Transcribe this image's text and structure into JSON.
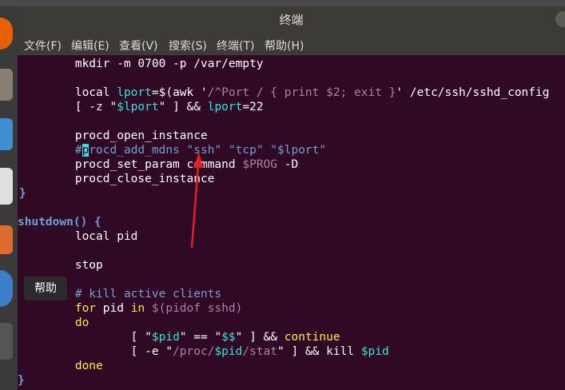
{
  "window": {
    "title": "终端",
    "top_text": "终端"
  },
  "menu": [
    "文件(F)",
    "编辑(E)",
    "查看(V)",
    "搜索(S)",
    "终端(T)",
    "帮助(H)"
  ],
  "tooltip": "帮助",
  "terminal": {
    "l1": "        mkdir -m 0700 -p /var/empty",
    "l2a": "        local ",
    "l2b": "lport",
    "l2c": "=$(awk '",
    "l2d": "/^Port / { print $2; exit }",
    "l2e": "' /etc/ssh/sshd_config",
    "l3a": "        [ -z \"",
    "l3b": "$lport",
    "l3c": "\" ] && ",
    "l3d": "lport",
    "l3e": "=22",
    "l4": "        procd_open_instance",
    "l5a": "        #",
    "l5b": "p",
    "l5c": "rocd_add_mdns \"ssh\" \"tcp\" \"$lport\"",
    "l6a": "        procd_set_param command ",
    "l6b": "$PROG",
    "l6c": " -D",
    "l7": "        procd_close_instance",
    "l8": "}",
    "l9": "shutdown() {",
    "l10": "        local pid",
    "l11": "        stop",
    "l12": "        # kill active clients",
    "l13a": "        for ",
    "l13b": "pid",
    "l13c": " in ",
    "l13d": "$(pidof sshd)",
    "l14": "        do",
    "l15a": "                [ \"",
    "l15b": "$pid",
    "l15c": "\" == \"",
    "l15d": "$$",
    "l15e": "\" ] && ",
    "l15f": "continue",
    "l16a": "                [ -e \"",
    "l16b": "/proc/",
    "l16c": "$pid",
    "l16d": "/stat",
    "l16e": "\" ] && kill ",
    "l16f": "$pid",
    "l17": "        done",
    "l18": "}"
  }
}
